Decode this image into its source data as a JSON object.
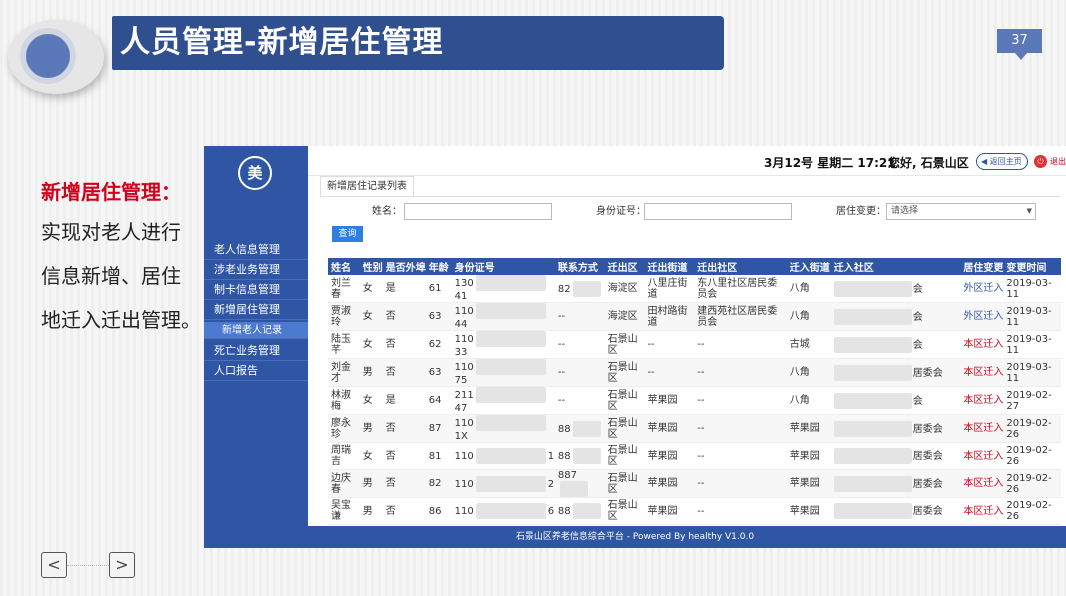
{
  "slide": {
    "title": "人员管理-新增居住管理",
    "page_number": "37",
    "left_heading": "新增居住管理：",
    "left_body_lines": [
      "实现对老人进行",
      "信息新增、居住",
      "地迁入迁出管理。"
    ]
  },
  "nav": {
    "prev_label": "<",
    "next_label": ">"
  },
  "app": {
    "logo_text": "美",
    "sidebar": {
      "items": [
        "老人信息管理",
        "涉老业务管理",
        "制卡信息管理",
        "新增居住管理"
      ],
      "sub_item": "新增老人记录",
      "items_after": [
        "死亡业务管理",
        "人口报告"
      ]
    },
    "topbar": {
      "date": "3月12号 星期二 17:21",
      "greeting": "您好, 石景山区",
      "home_label": "返回主页",
      "logout_label": "退出"
    },
    "tab_label": "新增居住记录列表",
    "filters": {
      "name_label": "姓名：",
      "id_label": "身份证号：",
      "change_label": "居住变更：",
      "change_selected": "请选择",
      "query_label": "查询"
    },
    "table": {
      "headers": [
        "姓名",
        "性别",
        "是否外埠",
        "年龄",
        "身份证号",
        "联系方式",
        "迁出区",
        "迁出街道",
        "迁出社区",
        "迁入街道",
        "迁入社区",
        "居住变更",
        "变更时间"
      ],
      "rows": [
        {
          "name": "刘兰春",
          "gender": "女",
          "outside": "是",
          "age": "61",
          "id_start": "130",
          "id_end": "41",
          "phone_start": "82",
          "phone_end": "",
          "out_district": "海淀区",
          "out_street": "八里庄街道",
          "out_community": "东八里社区居民委员会",
          "in_street": "八角",
          "in_community_end": "会",
          "change": "外区迁入",
          "time": "2019-03-11"
        },
        {
          "name": "贾淑玲",
          "gender": "女",
          "outside": "否",
          "age": "63",
          "id_start": "110",
          "id_end": "44",
          "phone_start": "--",
          "phone_end": "",
          "out_district": "海淀区",
          "out_street": "田村路街道",
          "out_community": "建西苑社区居民委员会",
          "in_street": "八角",
          "in_community_end": "会",
          "change": "外区迁入",
          "time": "2019-03-11"
        },
        {
          "name": "陆玉芊",
          "gender": "女",
          "outside": "否",
          "age": "62",
          "id_start": "110",
          "id_end": "33",
          "phone_start": "--",
          "phone_end": "",
          "out_district": "石景山区",
          "out_street": "--",
          "out_community": "--",
          "in_street": "古城",
          "in_community_end": "会",
          "change": "本区迁入",
          "time": "2019-03-11"
        },
        {
          "name": "刘金才",
          "gender": "男",
          "outside": "否",
          "age": "63",
          "id_start": "110",
          "id_end": "75",
          "phone_start": "--",
          "phone_end": "",
          "out_district": "石景山区",
          "out_street": "--",
          "out_community": "--",
          "in_street": "八角",
          "in_community_end": "居委会",
          "change": "本区迁入",
          "time": "2019-03-11"
        },
        {
          "name": "林淑梅",
          "gender": "女",
          "outside": "是",
          "age": "64",
          "id_start": "211",
          "id_end": "47",
          "phone_start": "--",
          "phone_end": "",
          "out_district": "石景山区",
          "out_street": "苹果园",
          "out_community": "--",
          "in_street": "八角",
          "in_community_end": "会",
          "change": "本区迁入",
          "time": "2019-02-27"
        },
        {
          "name": "廖永珍",
          "gender": "男",
          "outside": "否",
          "age": "87",
          "id_start": "110",
          "id_end": "1X",
          "phone_start": "88",
          "phone_end": "",
          "out_district": "石景山区",
          "out_street": "苹果园",
          "out_community": "--",
          "in_street": "苹果园",
          "in_community_end": "居委会",
          "change": "本区迁入",
          "time": "2019-02-26"
        },
        {
          "name": "周瑞吉",
          "gender": "女",
          "outside": "否",
          "age": "81",
          "id_start": "110",
          "id_end": "1",
          "phone_start": "88",
          "phone_end": "",
          "out_district": "石景山区",
          "out_street": "苹果园",
          "out_community": "--",
          "in_street": "苹果园",
          "in_community_end": "居委会",
          "change": "本区迁入",
          "time": "2019-02-26"
        },
        {
          "name": "边庆春",
          "gender": "男",
          "outside": "否",
          "age": "82",
          "id_start": "110",
          "id_end": "2",
          "phone_start": "887",
          "phone_end": "",
          "out_district": "石景山区",
          "out_street": "苹果园",
          "out_community": "--",
          "in_street": "苹果园",
          "in_community_end": "居委会",
          "change": "本区迁入",
          "time": "2019-02-26"
        },
        {
          "name": "吴宝谦",
          "gender": "男",
          "outside": "否",
          "age": "86",
          "id_start": "110",
          "id_end": "6",
          "phone_start": "88",
          "phone_end": "",
          "out_district": "石景山区",
          "out_street": "苹果园",
          "out_community": "--",
          "in_street": "苹果园",
          "in_community_end": "居委会",
          "change": "本区迁入",
          "time": "2019-02-26"
        }
      ]
    },
    "footer": "石景山区养老信息综合平台 - Powered By healthy V1.0.0"
  },
  "colors": {
    "title_bg": "#2f4f8f",
    "app_blue": "#2f56a4",
    "accent_red": "#d0021b"
  }
}
